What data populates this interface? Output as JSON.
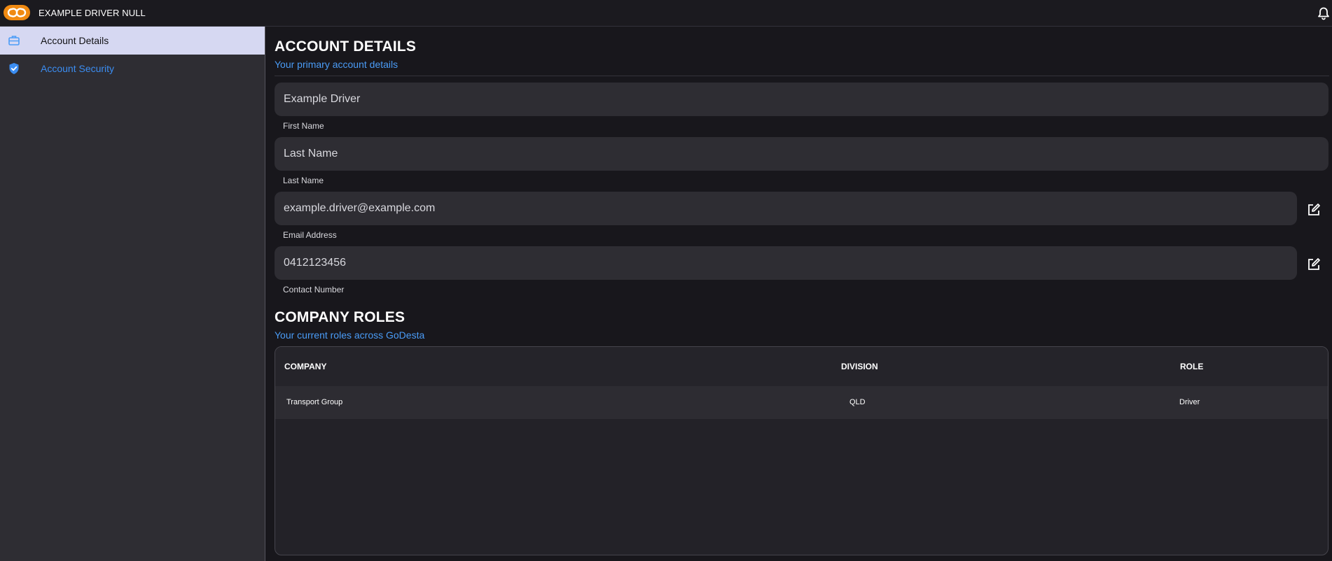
{
  "header": {
    "app_title": "EXAMPLE DRIVER NULL",
    "brand_color": "#f08a12"
  },
  "sidebar": {
    "items": [
      {
        "label": "Account Details",
        "icon": "briefcase-icon",
        "active": true
      },
      {
        "label": "Account Security",
        "icon": "shield-check-icon",
        "active": false
      }
    ]
  },
  "account_details": {
    "title": "ACCOUNT DETAILS",
    "subtitle": "Your primary account details",
    "fields": {
      "first_name": {
        "value": "Example Driver",
        "label": "First Name"
      },
      "last_name": {
        "placeholder": "Last Name",
        "label": "Last Name"
      },
      "email": {
        "value": "example.driver@example.com",
        "label": "Email Address"
      },
      "contact": {
        "value": "0412123456",
        "label": "Contact Number"
      }
    }
  },
  "company_roles": {
    "title": "COMPANY ROLES",
    "subtitle": "Your current roles across GoDesta",
    "columns": [
      "COMPANY",
      "DIVISION",
      "ROLE"
    ],
    "rows": [
      [
        "Transport Group",
        "QLD",
        "Driver"
      ]
    ]
  },
  "colors": {
    "accent_blue": "#4a9cf7",
    "active_sidebar_bg": "#d6d8f2"
  }
}
